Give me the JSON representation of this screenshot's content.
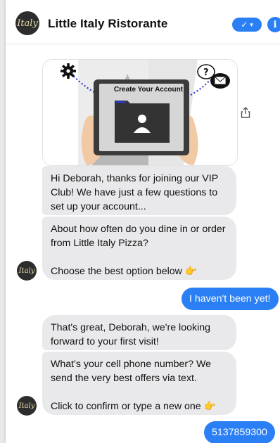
{
  "header": {
    "logo_text": "Italy",
    "title": "Little Italy Ristorante",
    "check_glyph": "✓",
    "dropdown_glyph": "▾",
    "info_glyph": "i"
  },
  "image_card": {
    "caption": "Create Your Account",
    "icons": [
      "gear-icon",
      "folder-icon",
      "user-icon",
      "chat-bubble-icon",
      "question-icon",
      "email-icon"
    ]
  },
  "messages": [
    {
      "from": "bot",
      "text": "Hi Deborah, thanks for joining our VIP Club! We have just a few questions to set up your account..."
    },
    {
      "from": "bot",
      "text": "About how often do you dine in or order from Little Italy Pizza?\n\nChoose the best option below 👉"
    },
    {
      "from": "user",
      "text": "I haven't been yet!"
    },
    {
      "from": "bot",
      "text": "That's great, Deborah, we're looking forward to your first visit!"
    },
    {
      "from": "bot",
      "text": "What's your cell phone number? We send the very best offers via text.\n\nClick to confirm or type a new one 👉"
    },
    {
      "from": "user",
      "text": "5137859300"
    }
  ],
  "avatar_text": "Italy",
  "colors": {
    "accent": "#2b7ff5",
    "bot_bubble": "#e9e9eb",
    "logo_bg": "#2d2d2d"
  }
}
